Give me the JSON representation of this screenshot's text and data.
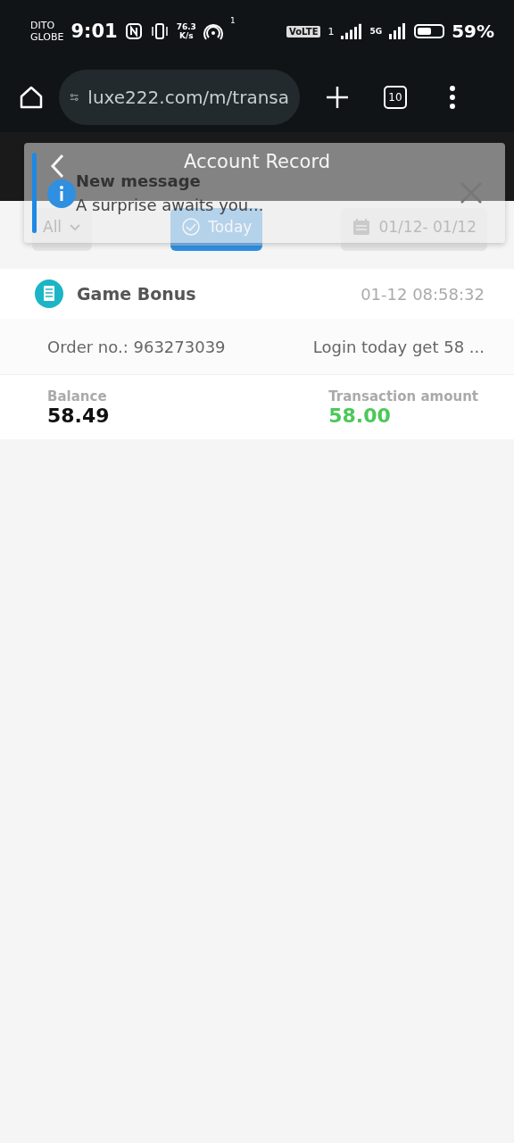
{
  "status_bar": {
    "carrier": [
      "DITO",
      "GLOBE"
    ],
    "time": "9:01",
    "speed": [
      "76.3",
      "K/s"
    ],
    "hotspot_count": "1",
    "volte": "VoLTE",
    "volte_sim": "1",
    "network": "5G",
    "battery": {
      "text": "59%"
    }
  },
  "browser": {
    "url": "luxe222.com/m/transa",
    "tab_count": "10"
  },
  "header": {
    "title": "Account Record"
  },
  "filters": [
    {
      "kind": "dropdown",
      "label": "All",
      "selected": false
    },
    {
      "kind": "chip",
      "label": "Today",
      "selected": true
    },
    {
      "kind": "date",
      "label": "01/12- 01/12",
      "selected": false
    }
  ],
  "records": [
    {
      "type": "Game Bonus",
      "time": "01-12 08:58:32",
      "order": "Order no.: 963273039",
      "note": "Login today get 58 ...",
      "balance_label": "Balance",
      "balance": "58.49",
      "amount_label": "Transaction amount",
      "amount": "58.00"
    }
  ],
  "toast": {
    "title": "New message",
    "text": "A surprise awaits you..."
  }
}
